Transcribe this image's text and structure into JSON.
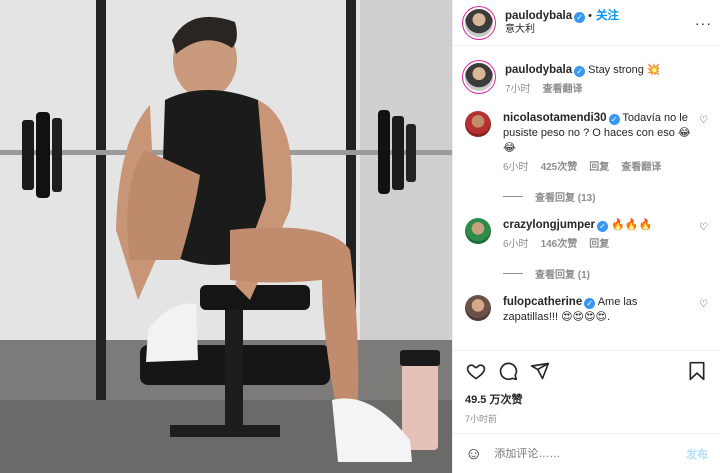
{
  "post": {
    "author": "paulodybala",
    "location": "意大利",
    "follow_label": "关注",
    "dot": "•",
    "more": "···",
    "caption_text": "Stay strong",
    "caption_emoji": "💥",
    "caption_time": "7小时",
    "caption_translate": "查看翻译"
  },
  "comments": [
    {
      "user": "nicolasotamendi30",
      "text": "Todavía no le pusiste peso no ? O haces con eso 😂😂",
      "time": "6小时",
      "likes": "425次赞",
      "reply": "回复",
      "translate": "查看翻译",
      "view_replies": "查看回复 (13)"
    },
    {
      "user": "crazylongjumper",
      "text": "🔥🔥🔥",
      "time": "6小时",
      "likes": "146次赞",
      "reply": "回复",
      "view_replies": "查看回复 (1)"
    },
    {
      "user": "fulopcatherine",
      "text": "Ame las zapatillas!!! 😍😍😍😍."
    }
  ],
  "stats": {
    "likes": "49.5 万次赞",
    "ago": "7小时前"
  },
  "composer": {
    "emoji": "☺",
    "placeholder": "添加评论……",
    "post_label": "发布"
  },
  "icons": {
    "like": "heart-icon",
    "comment": "comment-icon",
    "share": "share-icon",
    "save": "bookmark-icon",
    "comment_like": "small-heart-icon"
  },
  "colors": {
    "accent": "#0095f6",
    "verified": "#3897f0",
    "muted": "#8e8e8e",
    "text": "#262626",
    "post_disabled": "#b2dffc"
  }
}
